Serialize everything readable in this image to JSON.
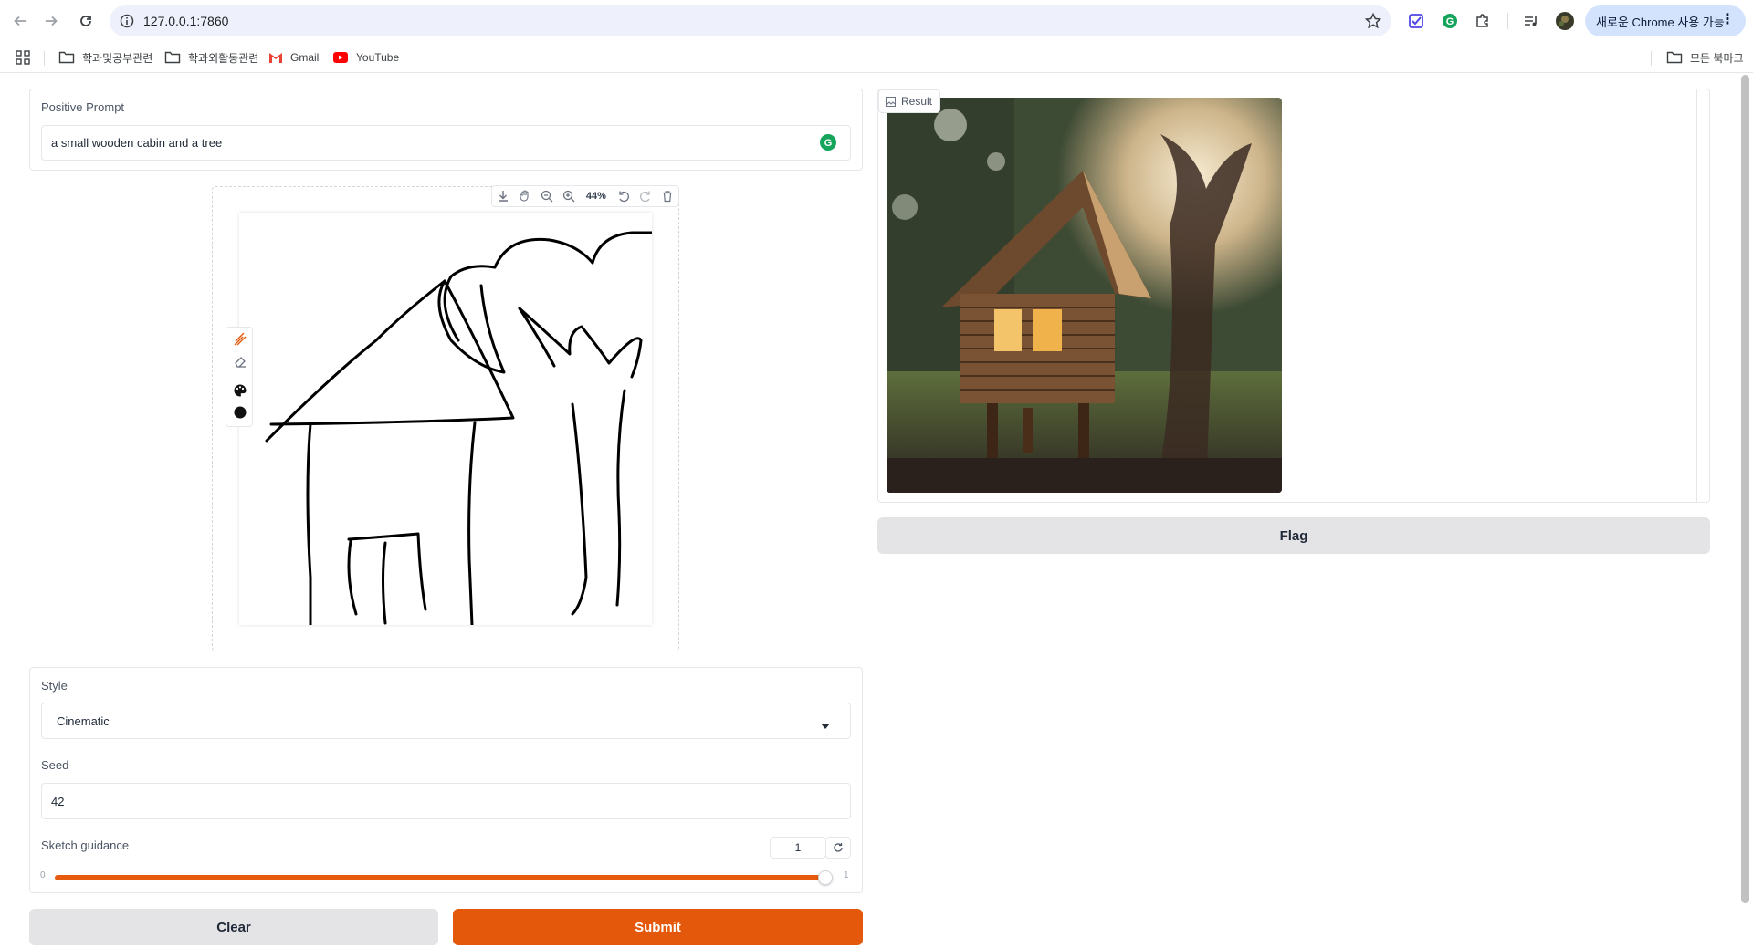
{
  "browser": {
    "url": "127.0.0.1:7860",
    "chrome_pill_label": "새로운 Chrome 사용 가능",
    "bookmarks": [
      {
        "label": "학과및공부관련",
        "icon": "folder-icon"
      },
      {
        "label": "학과외활동관련",
        "icon": "folder-icon"
      },
      {
        "label": "Gmail",
        "icon": "gmail-icon"
      },
      {
        "label": "YouTube",
        "icon": "youtube-icon"
      }
    ],
    "all_bookmarks_label": "모든 북마크"
  },
  "prompt": {
    "label": "Positive Prompt",
    "value": "a small wooden cabin and a tree"
  },
  "sketch": {
    "zoom": "44%"
  },
  "style": {
    "label": "Style",
    "selected": "Cinematic"
  },
  "seed": {
    "label": "Seed",
    "value": "42"
  },
  "guidance": {
    "label": "Sketch guidance",
    "value": "1",
    "min": "0",
    "max": "1",
    "fill_fraction": 1.0
  },
  "buttons": {
    "clear": "Clear",
    "submit": "Submit",
    "flag": "Flag"
  },
  "result": {
    "label": "Result"
  },
  "colors": {
    "accent": "#e3580b",
    "secondary_button": "#e4e4e7"
  }
}
